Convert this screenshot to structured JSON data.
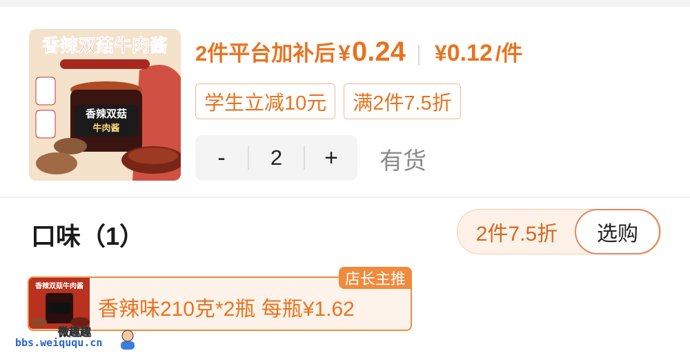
{
  "product": {
    "image_icon": "product-jar-image",
    "image_text": "香辣双菇牛肉酱",
    "price_prefix": "2件平台加补后",
    "currency": "¥",
    "price": "0.24",
    "unit_price": "0.12",
    "unit_suffix": "/件",
    "tags": [
      "学生立减10元",
      "满2件7.5折"
    ],
    "quantity": "2",
    "minus_label": "-",
    "plus_label": "+",
    "stock": "有货"
  },
  "flavor": {
    "title": "口味（1）",
    "combo_discount": "2件7.5折",
    "select_label": "选购",
    "option": {
      "label": "香辣味210克*2瓶  每瓶¥1.62",
      "badge": "店长主推",
      "thumb_text": "香辣双菇牛肉酱"
    }
  },
  "watermark": {
    "title": "微趣趣",
    "url": "bbs.weiququ.cn"
  },
  "colors": {
    "accent": "#e8731f",
    "badge": "#f08a3c",
    "stock_gray": "#8a8a8a"
  }
}
